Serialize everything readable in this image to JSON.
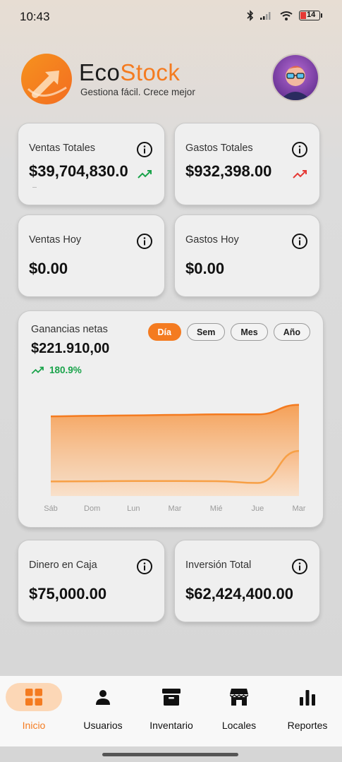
{
  "status": {
    "time": "10:43",
    "battery": "14"
  },
  "header": {
    "brand_part1": "Eco",
    "brand_part2": "Stock",
    "tagline": "Gestiona fácil. Crece mejor"
  },
  "cards": {
    "ventas_totales": {
      "label": "Ventas Totales",
      "value": "$39,704,830.0",
      "trend": "up"
    },
    "gastos_totales": {
      "label": "Gastos Totales",
      "value": "$932,398.00",
      "trend": "up"
    },
    "ventas_hoy": {
      "label": "Ventas Hoy",
      "value": "$0.00"
    },
    "gastos_hoy": {
      "label": "Gastos Hoy",
      "value": "$0.00"
    },
    "dinero_caja": {
      "label": "Dinero en Caja",
      "value": "$75,000.00"
    },
    "inversion_total": {
      "label": "Inversión Total",
      "value": "$62,424,400.00"
    }
  },
  "earnings": {
    "title": "Ganancias netas",
    "value": "$221.910,00",
    "growth": "180.9%",
    "ranges": [
      "Día",
      "Sem",
      "Mes",
      "Año"
    ],
    "active_range": "Día"
  },
  "chart_data": {
    "type": "area",
    "x": [
      "Sáb",
      "Dom",
      "Lun",
      "Mar",
      "Mié",
      "Jue",
      "Mar"
    ],
    "series": [
      {
        "values": [
          0.795,
          0.8,
          0.805,
          0.81,
          0.815,
          0.815,
          0.91
        ]
      },
      {
        "values": [
          0.145,
          0.147,
          0.15,
          0.15,
          0.148,
          0.13,
          0.45
        ]
      }
    ],
    "ylim": [
      0,
      1
    ],
    "grid": false,
    "colors": {
      "top": "#f47b20",
      "bottom": "#f7a046"
    }
  },
  "nav": {
    "items": [
      {
        "label": "Inicio",
        "icon": "grid-icon"
      },
      {
        "label": "Usuarios",
        "icon": "user-icon"
      },
      {
        "label": "Inventario",
        "icon": "archive-icon"
      },
      {
        "label": "Locales",
        "icon": "store-icon"
      },
      {
        "label": "Reportes",
        "icon": "bar-chart-icon"
      }
    ],
    "active": "Inicio"
  },
  "colors": {
    "accent": "#f47b20",
    "positive": "#19a34a",
    "negative": "#e53935"
  }
}
